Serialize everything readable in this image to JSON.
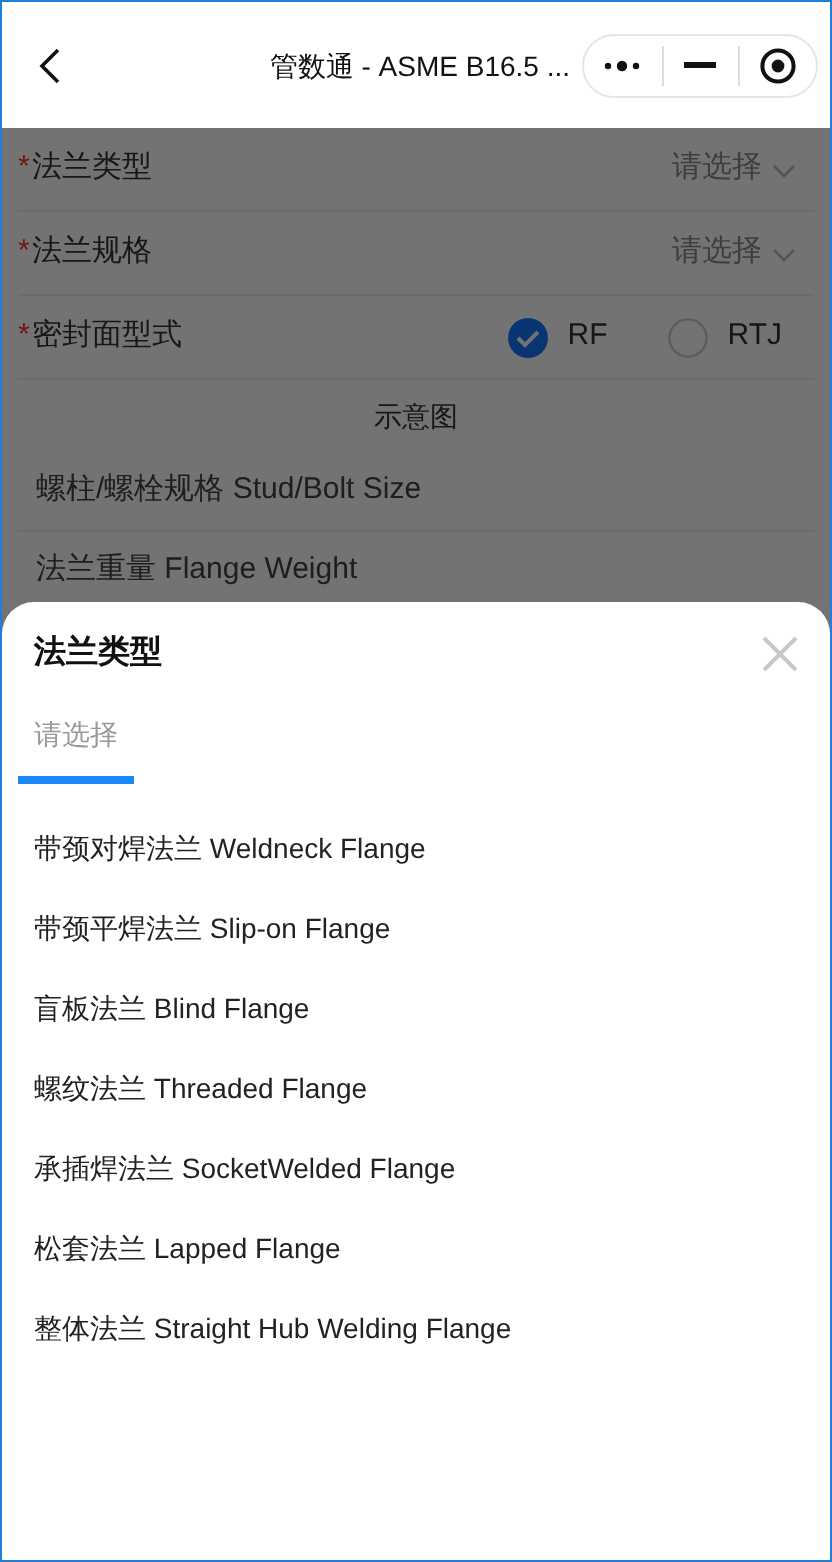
{
  "header": {
    "title": "管数通 - ASME B16.5 ..."
  },
  "form": {
    "fields": [
      {
        "kind": "select",
        "label": "法兰类型",
        "marker": "*",
        "placeholder": "请选择"
      },
      {
        "kind": "select",
        "label": "法兰规格",
        "marker": "*",
        "placeholder": "请选择"
      },
      {
        "kind": "radio",
        "label": "密封面型式",
        "marker": "*",
        "options": [
          {
            "label": "RF",
            "selected": true
          },
          {
            "label": "RTJ",
            "selected": false
          }
        ]
      }
    ],
    "diagram_label": "示意图",
    "results": [
      "螺柱/螺栓规格 Stud/Bolt Size",
      "法兰重量 Flange Weight"
    ]
  },
  "sheet": {
    "title": "法兰类型",
    "tabs": [
      {
        "label": "请选择",
        "selected": true
      }
    ],
    "options": [
      "带颈对焊法兰 Weldneck Flange",
      "带颈平焊法兰 Slip-on Flange",
      "盲板法兰 Blind Flange",
      "螺纹法兰 Threaded Flange",
      "承插焊法兰 SocketWelded Flange",
      "松套法兰 Lapped Flange",
      "整体法兰 Straight Hub Welding Flange"
    ]
  }
}
